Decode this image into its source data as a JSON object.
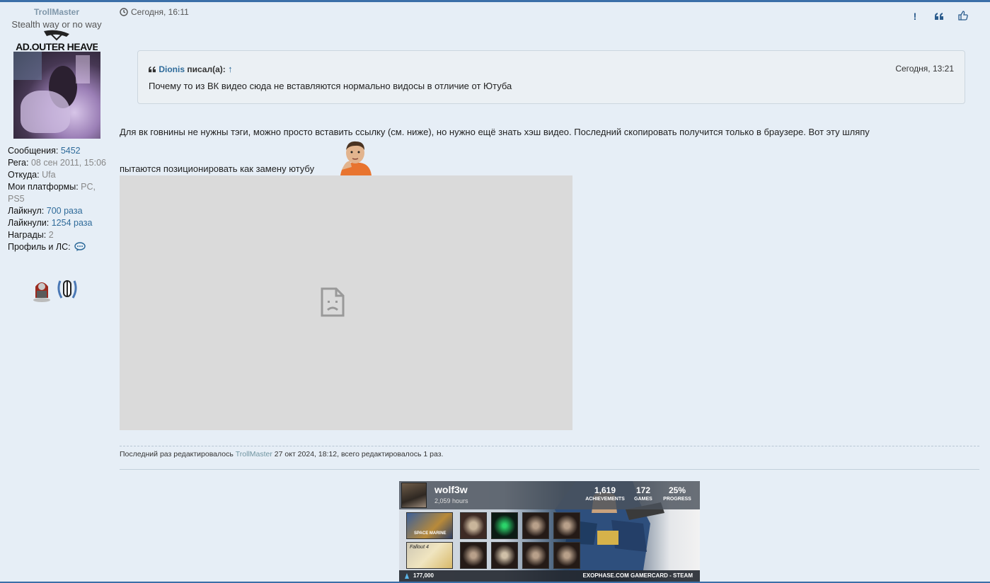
{
  "profile": {
    "username": "TrollMaster",
    "user_title": "Stealth way or no way",
    "rank_text": "MAD.OUTER HEAVEN",
    "fields": {
      "messages_label": "Сообщения:",
      "messages_value": "5452",
      "reg_label": "Рега:",
      "reg_value": "08 сен 2011, 15:06",
      "from_label": "Откуда:",
      "from_value": "Ufa",
      "platforms_label": "Мои платформы:",
      "platforms_value": "PC, PS5",
      "liked_label": "Лайкнул:",
      "liked_value": "700 раза",
      "liked_by_label": "Лайкнули:",
      "liked_by_value": "1254 раза",
      "awards_label": "Награды:",
      "awards_value": "2",
      "profile_label": "Профиль и ЛС:"
    }
  },
  "post": {
    "time": "Сегодня, 16:11",
    "buttons": {
      "report": "!",
      "quote": "❝",
      "like": "👍"
    },
    "quote": {
      "author": "Dionis",
      "wrote": "писал(а):",
      "arrow": "↑",
      "date": "Сегодня, 13:21",
      "text": "Почему то из ВК видео сюда не вставляются нормально видосы в отличие от Ютуба"
    },
    "content_line1": "Для вк говнины не нужны тэги, можно просто вставить ссылку (см. ниже), но нужно ещё знать хэш видео. Последний скопировать получится только в браузере. Вот эту шляпу",
    "content_line2": "пытаются позиционировать как замену ютубу",
    "edit_notice": {
      "prefix": "Последний раз редактировалось",
      "who": "TrollMaster",
      "suffix": "27 окт 2024, 18:12, всего редактировалось 1 раз."
    }
  },
  "gamercard": {
    "name": "wolf3w",
    "hours": "2,059 hours",
    "achievements_value": "1,619",
    "achievements_label": "ACHIEVEMENTS",
    "games_value": "172",
    "games_label": "GAMES",
    "progress_value": "25%",
    "progress_label": "PROGRESS",
    "points": "177,000",
    "brand": "EXOPHASE.COM GAMERCARD - STEAM",
    "tile1_caption": "SPACE MARINE",
    "tile2_caption": "Fallout 4"
  },
  "colors": {
    "accent": "#3b6fa8",
    "link": "#2f6b9a",
    "username": "#7f97aa",
    "background": "#e6eef6"
  }
}
